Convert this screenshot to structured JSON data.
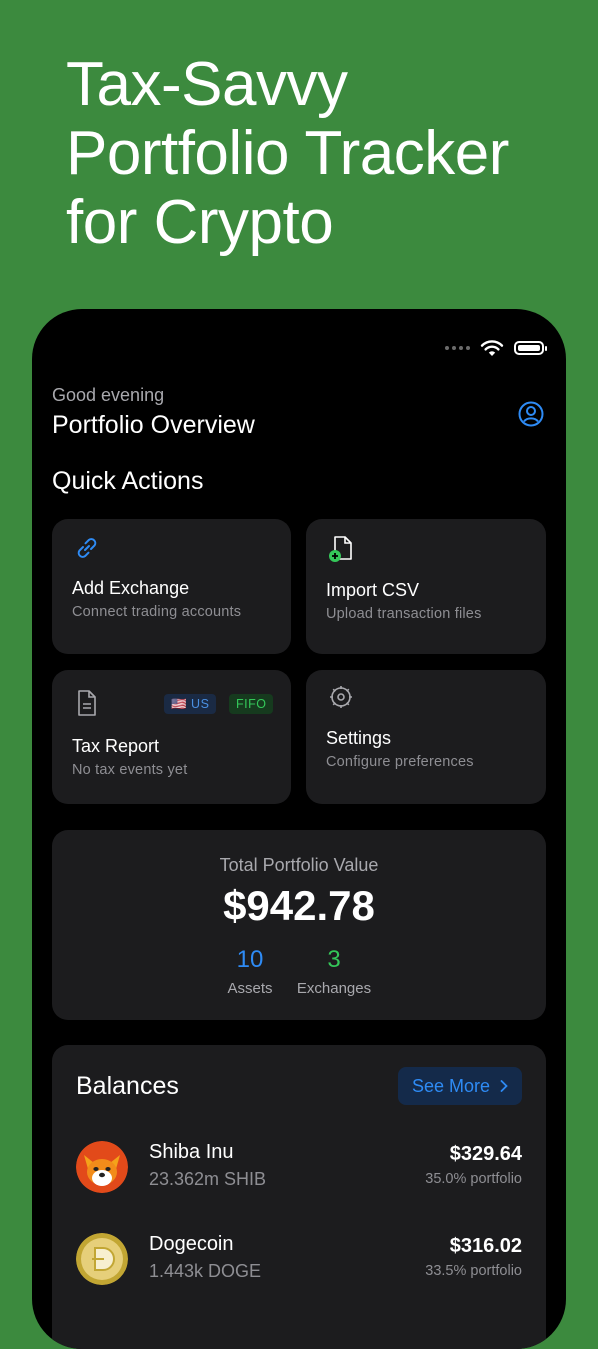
{
  "headline": {
    "line1": "Tax-Savvy",
    "line2": "Portfolio Tracker",
    "line3": "for Crypto"
  },
  "header": {
    "greeting": "Good evening",
    "title": "Portfolio Overview",
    "profile_icon": "person-circle-icon"
  },
  "quick_actions": {
    "title": "Quick Actions",
    "items": [
      {
        "label": "Add Exchange",
        "sub": "Connect trading accounts",
        "icon": "link-icon"
      },
      {
        "label": "Import CSV",
        "sub": "Upload transaction files",
        "icon": "file-plus-icon"
      },
      {
        "label": "Tax Report",
        "sub": "No tax events yet",
        "icon": "document-icon",
        "badges": [
          "🇺🇸 US",
          "FIFO"
        ]
      },
      {
        "label": "Settings",
        "sub": "Configure preferences",
        "icon": "gear-icon"
      }
    ]
  },
  "total": {
    "label": "Total Portfolio Value",
    "value": "$942.78",
    "assets_count": "10",
    "assets_label": "Assets",
    "exchanges_count": "3",
    "exchanges_label": "Exchanges"
  },
  "balances": {
    "title": "Balances",
    "see_more": "See More",
    "rows": [
      {
        "name": "Shiba Inu",
        "amount": "23.362m SHIB",
        "value": "$329.64",
        "pct": "35.0% portfolio"
      },
      {
        "name": "Dogecoin",
        "amount": "1.443k DOGE",
        "value": "$316.02",
        "pct": "33.5% portfolio"
      }
    ]
  },
  "colors": {
    "background": "#3c8a3e",
    "accent_blue": "#2e8bf5",
    "accent_green": "#34c759",
    "card": "#1c1c1e"
  }
}
